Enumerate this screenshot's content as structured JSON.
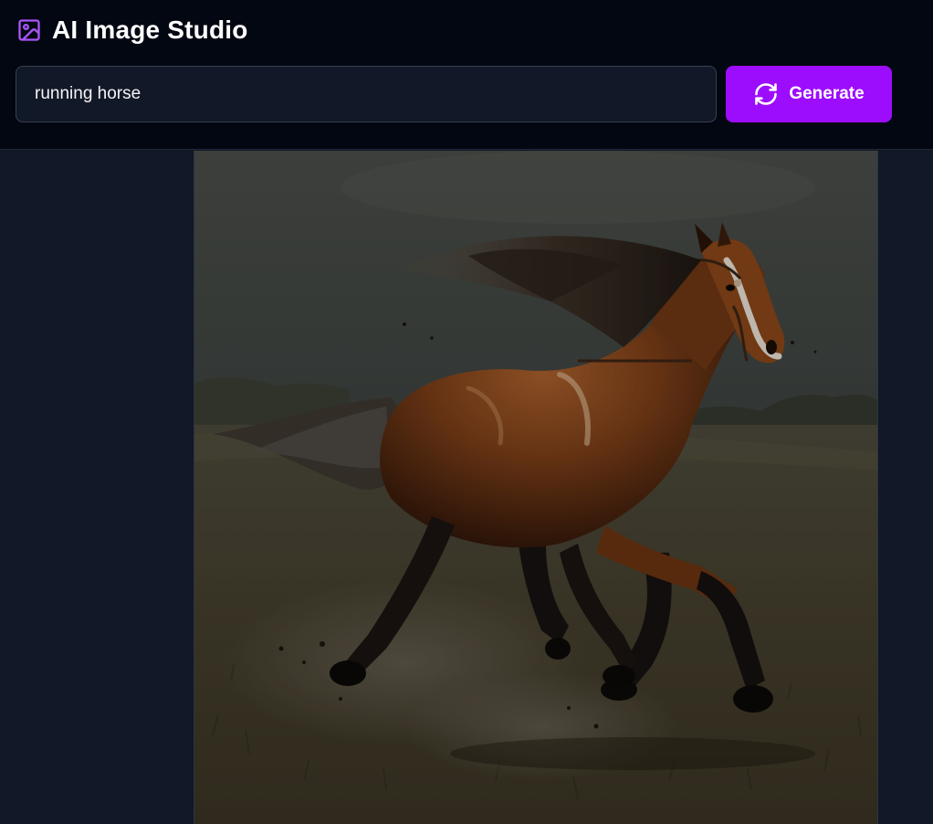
{
  "app": {
    "title": "AI Image Studio",
    "logo_icon": "image-icon",
    "accent_color": "#9d0dfd"
  },
  "prompt": {
    "value": "running horse",
    "placeholder": ""
  },
  "generate_button": {
    "label": "Generate",
    "icon": "refresh-icon"
  },
  "generated_image": {
    "alt": "running horse"
  }
}
